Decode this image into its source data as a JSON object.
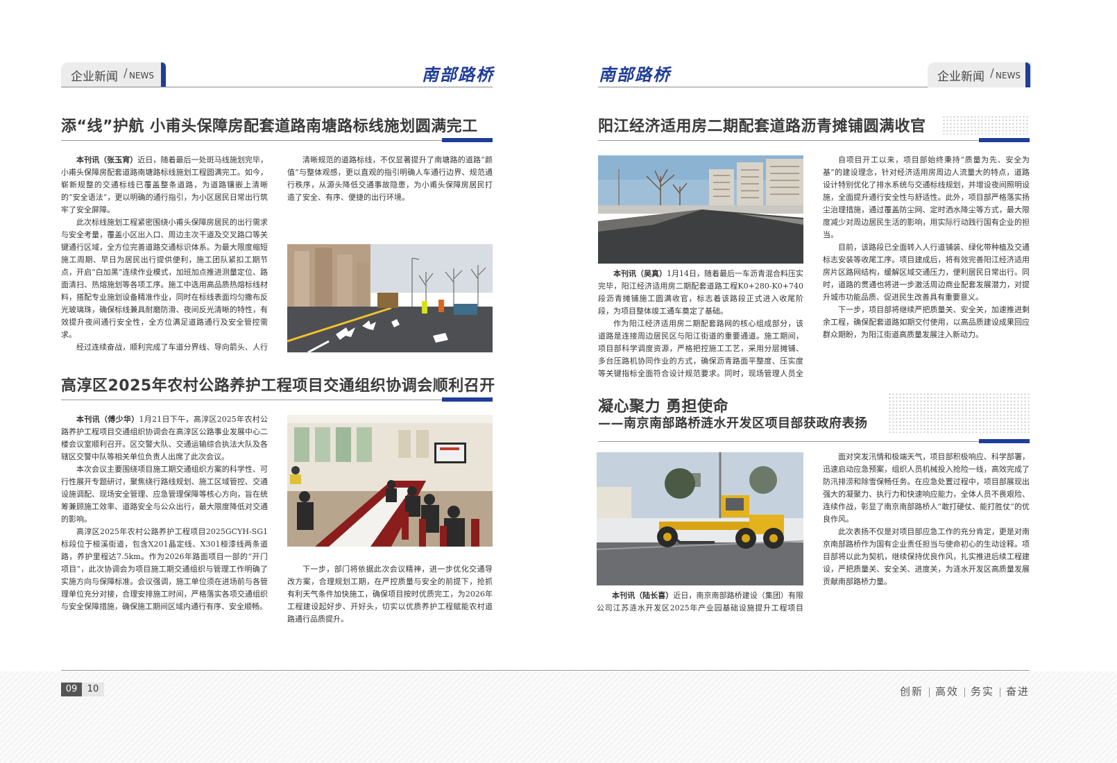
{
  "header": {
    "tab_zh": "企业新闻",
    "tab_slash": "/",
    "tab_en": "NEWS",
    "brand": "南部路桥"
  },
  "left": {
    "article1": {
      "title": "添“线”护航  小甫头保障房配套道路南塘路标线施划圆满完工",
      "byline": "本刊讯（张玉宵）",
      "p1": "近日，随着最后一处斑马线施划完毕，小甫头保障房配套道路南塘路标线施划工程圆满完工。如今，崭新规整的交通标线已覆盖整条道路，为道路镶嵌上清晰的“安全语法”，更以明确的通行指引，为小区居民日常出行筑牢了安全屏障。",
      "p2": "此次标线施划工程紧密围绕小甫头保障房居民的出行需求与安全考量，覆盖小区出入口、周边主次干道及交叉路口等关键通行区域，全方位完善道路交通标识体系。为最大限度缩短施工周期、早日为居民出行提供便利，施工团队紧扣工期节点，开启“白加黑”连续作业模式，加班加点推进测量定位、路面清扫、热熔施划等各项工序。施工中选用高品质热熔标线材料，搭配专业施划设备精准作业，同时在标线表面均匀撒布反光玻璃珠，确保标线兼具耐磨防滑、夜间反光清晰的特性，有效提升夜间通行安全性，全方位满足道路通行及安全管控需求。",
      "p3": "经过连续奋战，顺利完成了车道分界线、导向箭头、人行斑马线、禁停区域标识等全类型交通标线施划，实现道路标线全覆盖、无遗漏，为道路通行秩序规范提供了坚实基础。",
      "p4": "清晰规范的道路标线，不仅显著提升了南塘路的道路“颜值”与整体观感，更以直观的指引明确人车通行边界、规范通行秩序，从源头降低交通事故隐患，为小甫头保障房居民打造了安全、有序、便捷的出行环境。"
    },
    "article2": {
      "title": "高淳区2025年农村公路养护工程项目交通组织协调会顺利召开",
      "byline": "本刊讯（傅少华）",
      "p1": "1月21日下午，高淳区2025年农村公路养护工程项目交通组织协调会在高淳区公路事业发展中心二楼会议室顺利召开。区交警大队、交通运输综合执法大队及各辖区交警中队等相关单位负责人出席了此次会议。",
      "p2": "本次会议主要围绕项目施工期交通组织方案的科学性、可行性展开专题研讨，聚焦绕行路线规划、施工区域管控、交通设施调配、现场安全管理、应急管理保障等核心方向，旨在统筹兼顾施工效率、道路安全与公众出行，最大限度降低对交通的影响。",
      "p3": "高淳区2025年农村公路养护工程项目2025GCYH-SG1标段位于桠溪街道，包含X201晶定线、X301桠漆线两条道路，养护里程达7.5km。作为2026年路面项目一部的“开门项目”，此次协调会为项目施工期交通组织与管理工作明确了实施方向与保障标准。会议强调，施工单位须在进场前与各管理单位充分对接，合理安排施工时间，严格落实各项交通组织与安全保障措施，确保施工期间区域内通行有序、安全顺畅。",
      "p4": "下一步，部门将依据此次会议精神，进一步优化交通导改方案，合理规划工期，在严控质量与安全的前提下，抢抓有利天气条件加快施工，确保项目按时优质完工，为2026年工程建设起好步、开好头，切实以优质养护工程赋能农村道路通行品质提升。"
    }
  },
  "right": {
    "article3": {
      "title": "阳江经济适用房二期配套道路沥青摊铺圆满收官",
      "byline": "本刊讯（吴真）",
      "p1": "1月14日，随着最后一车沥青混合料压实完毕，阳江经济适用房二期配套道路工程K0+280-K0+740段沥青摊铺施工圆满收官，标志着该路段正式进入收尾阶段，为项目整体竣工通车奠定了基础。",
      "p2": "作为阳江经济适用房二期配套路网的核心组成部分，该道路是连接周边居民区与阳江街道的重要通道。施工期间，项目部科学调度资源，严格把控施工工艺，采用分层摊铺、多台压路机协同作业的方式，确保沥青路面平整度、压实度等关键指标全面符合设计规范要求。同时，现场管理人员全程监督，对原材料质量、摊铺温度、碾压速度等环节实施动态管控，有效保障了工程质量与进度。",
      "p3": "自项目开工以来，项目部始终秉持“质量为先、安全为基”的建设理念，针对经济适用房周边人流量大的特点，道路设计特别优化了排水系统与交通标线规划，并增设夜间照明设施，全面提升通行安全性与舒适性。此外，项目部严格落实扬尘治理措施，通过覆盖防尘网、定时洒水降尘等方式，最大限度减少对周边居民生活的影响，用实际行动践行国有企业的担当。",
      "p4": "目前，该路段已全面转入人行道铺装、绿化带种植及交通标志安装等收尾工序。项目建成后，将有效完善阳江经济适用房片区路网结构，缓解区域交通压力，便利居民日常出行。同时，道路的贯通也将进一步激活周边商业配套发展潜力，对提升城市功能品质、促进民生改善具有重要意义。",
      "p5": "下一步，项目部将继续严把质量关、安全关，加速推进剩余工程，确保配套道路如期交付使用，以高品质建设成果回应群众期盼，为阳江街道高质量发展注入新动力。"
    },
    "article4": {
      "title": "凝心聚力 勇担使命",
      "subtitle": "——南京南部路桥涟水开发区项目部获政府表扬",
      "byline": "本刊讯（陆长喜）",
      "p1": "近日，南京南部路桥建设（集团）有限公司江苏涟水开发区2025年产业园基础设施提升工程项目部，在园区2025年度防汛排涝、除雪等应急处置工作中表现突出，获得园区管理部门的高度认可和书面表扬。",
      "p2": "面对突发汛情和极端天气，项目部积极响应、科学部署，迅速启动应急预案，组织人员机械投入抢险一线，高效完成了防汛排涝和除雪保畅任务。在应急处置过程中，项目部展现出强大的凝聚力、执行力和快速响应能力，全体人员不畏艰险、连续作战，彰显了南京南部路桥人“敢打硬仗、能打胜仗”的优良作风。",
      "p3": "此次表扬不仅是对项目部应急工作的充分肯定，更是对南京南部路桥作为国有企业责任担当与使命初心的生动诠释。项目部将以此为契机，继续保持优良作风，扎实推进后续工程建设，严把质量关、安全关、进度关，为涟水开发区高质量发展贡献南部路桥力量。"
    }
  },
  "footer": {
    "page_left": "09",
    "page_right": "10",
    "slogan": [
      "创新",
      "高效",
      "务实",
      "奋进"
    ]
  },
  "colors": {
    "accent": "#1f3d99",
    "rule": "#999999",
    "text": "#333333"
  }
}
